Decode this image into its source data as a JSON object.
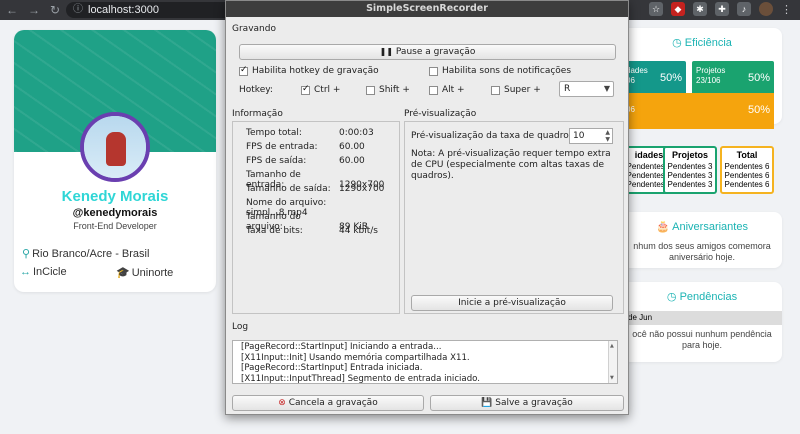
{
  "browser": {
    "url": "localhost:3000"
  },
  "profile": {
    "name": "Kenedy Morais",
    "handle": "@kenedymorais",
    "role": "Front-End Developer",
    "location": "Rio Branco/Acre - Brasil",
    "company": "InCicle",
    "school": "Uninorte"
  },
  "efficiency": {
    "title": "Eficiência",
    "box1": {
      "label_line1": "dades",
      "label_line2": "06",
      "pct": "50%",
      "color": "#14988a"
    },
    "box2": {
      "label_line1": "Projetos",
      "label_line2": "23/106",
      "pct": "50%",
      "color": "#1aa36f"
    },
    "box3": {
      "label": "06",
      "pct": "50%",
      "color": "#f5a40d"
    }
  },
  "pendings_grid": [
    {
      "title": "idades",
      "rows": [
        "Pendentes 3",
        "Pendentes 3",
        "Pendentes 3"
      ],
      "color": "#1aa36f"
    },
    {
      "title": "Projetos",
      "rows": [
        "Pendentes 3",
        "Pendentes 3",
        "Pendentes 3"
      ],
      "color": "#1aa36f"
    },
    {
      "title": "Total",
      "rows": [
        "Pendentes 6",
        "Pendentes 6",
        "Pendentes 6"
      ],
      "color": "#f5b320"
    }
  ],
  "birthdays": {
    "title": "Aniversariantes",
    "text_line1": "nhum dos seus amigos comemora",
    "text_line2": "aniversário hoje."
  },
  "pendencies": {
    "title": "Pendências",
    "row_head": "de Jun",
    "text_line1": "ocê não possui nunhum pendência",
    "text_line2": "para hoje."
  },
  "recorder": {
    "title": "SimpleScreenRecorder",
    "recording_section": "Gravando",
    "pause_button": "Pause a gravação",
    "hotkey_enable": "Habilita hotkey de gravação",
    "sound_enable": "Habilita sons de notificações",
    "hotkey_label": "Hotkey:",
    "ctrl": "Ctrl +",
    "shift": "Shift +",
    "alt": "Alt +",
    "super": "Super +",
    "key": "R",
    "info_section": "Informação",
    "info": [
      {
        "k": "Tempo total:",
        "v": "0:00:03"
      },
      {
        "k": "FPS de entrada:",
        "v": "60.00"
      },
      {
        "k": "FPS de saída:",
        "v": "60.00"
      },
      {
        "k": "Tamanho de entrada:",
        "v": "1290x700"
      },
      {
        "k": "Tamanho de saída:",
        "v": "1290x700"
      },
      {
        "k": "Nome do arquivo:",
        "v": "simpl...8.mp4"
      },
      {
        "k": "Tamanho do arquivo:",
        "v": "89 KiB"
      },
      {
        "k": "Taxa de bits:",
        "v": "44 kbit/s"
      }
    ],
    "preview_section": "Pré-visualização",
    "preview_rate_label": "Pré-visualização da taxa de quadros:",
    "preview_rate_value": "10",
    "preview_note": "Nota: A pré-visualização requer tempo extra de CPU (especialmente com altas taxas de quadros).",
    "start_preview": "Inicie a pré-visualização",
    "log_section": "Log",
    "log_lines": [
      "[PageRecord::StartInput] Iniciando a entrada...",
      "[X11Input::Init] Usando memória compartilhada X11.",
      "[PageRecord::StartInput] Entrada iniciada.",
      "[X11Input::InputThread] Segmento de entrada iniciado."
    ],
    "cancel_button": "Cancela a gravação",
    "save_button": "Salve a gravação"
  }
}
